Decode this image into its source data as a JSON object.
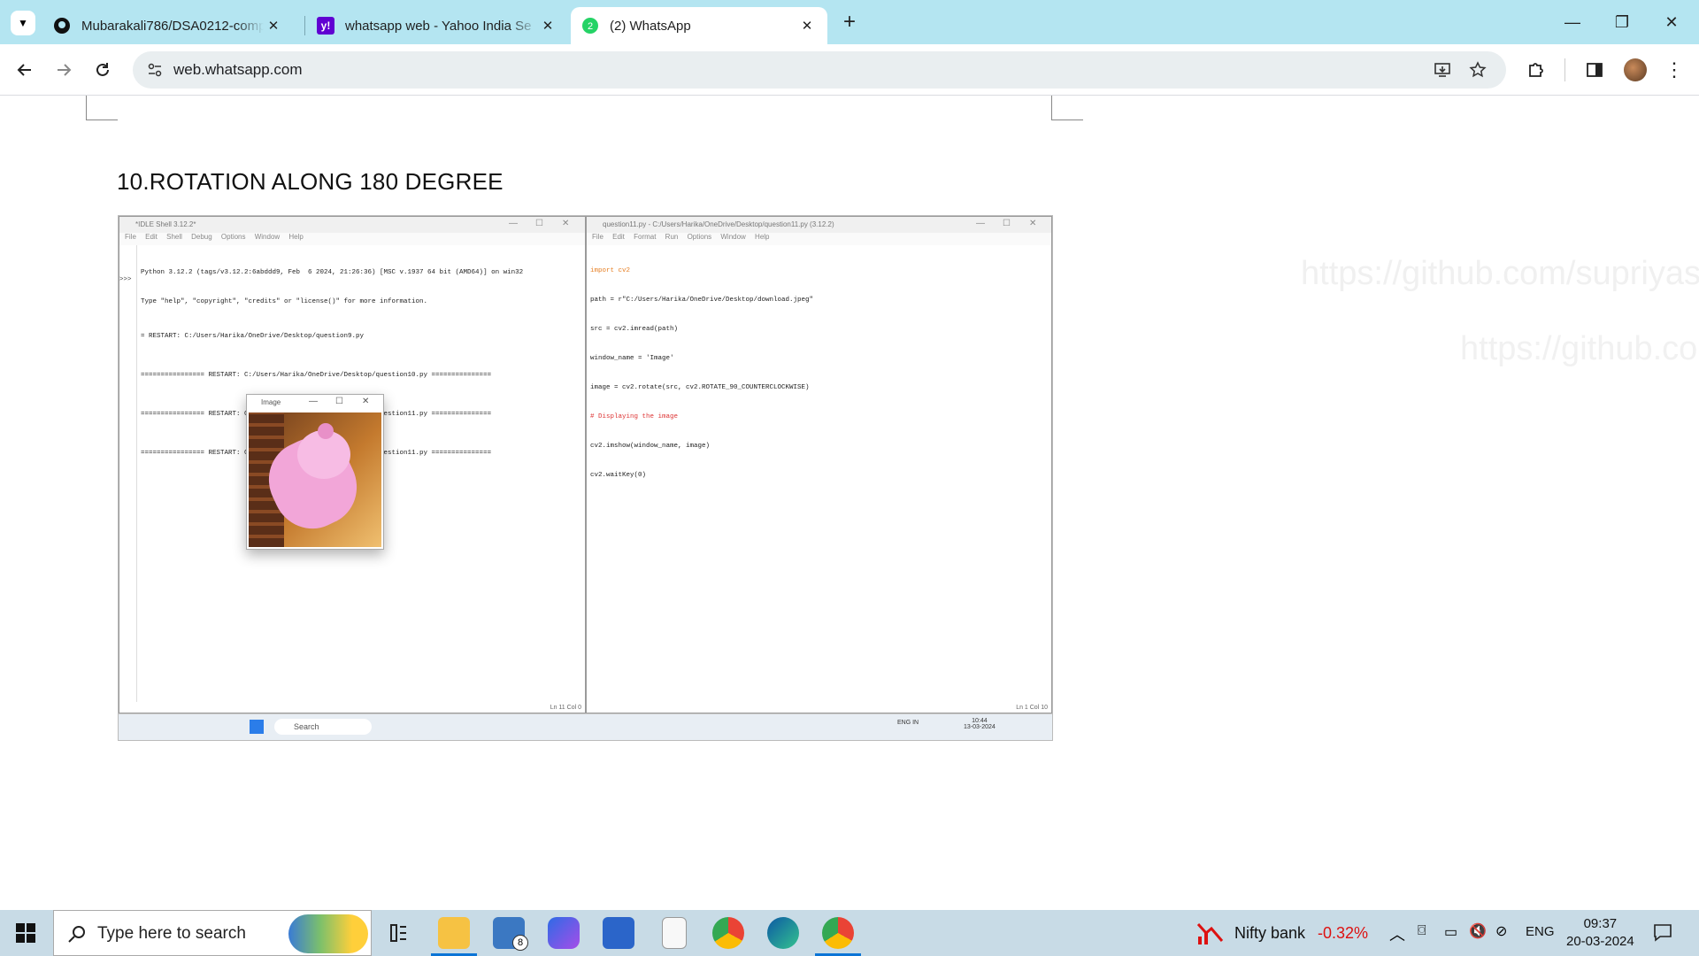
{
  "browser": {
    "tabs": [
      {
        "title": "Mubarakali786/DSA0212-comp",
        "icon": "github-icon",
        "active": false
      },
      {
        "title": "whatsapp web - Yahoo India Se",
        "icon": "yahoo-icon",
        "active": false
      },
      {
        "title": "(2) WhatsApp",
        "icon": "whatsapp-icon",
        "active": true
      }
    ],
    "url": "web.whatsapp.com"
  },
  "page": {
    "heading": "10.ROTATION ALONG 180 DEGREE",
    "shell": {
      "title": "*IDLE Shell 3.12.2*",
      "menu": "File Edit Shell Debug Options Window Help",
      "lines": [
        "Python 3.12.2 (tags/v3.12.2:6abddd9, Feb  6 2024, 21:26:36) [MSC v.1937 64 bit (AMD64)] on win32",
        "Type \"help\", \"copyright\", \"credits\" or \"license()\" for more information.",
        "= RESTART: C:/Users/Harika/OneDrive/Desktop/question9.py",
        "================ RESTART: C:/Users/Harika/OneDrive/Desktop/question10.py ===============",
        "================ RESTART: C:/Users/Harika/OneDrive/Desktop/question11.py ===============",
        "================ RESTART: C:/Users/Harika/OneDrive/Desktop/question11.py ==============="
      ],
      "status": "Ln 11  Col 0"
    },
    "editor": {
      "title": "question11.py - C:/Users/Harika/OneDrive/Desktop/question11.py (3.12.2)",
      "menu": "File Edit Format Run Options Window Help",
      "lines": [
        "import cv2",
        "path = r\"C:/Users/Harika/OneDrive/Desktop/download.jpeg\"",
        "src = cv2.imread(path)",
        "window_name = 'Image'",
        "image = cv2.rotate(src, cv2.ROTATE_90_COUNTERCLOCKWISE)",
        "# Displaying the image",
        "cv2.imshow(window_name, image)",
        "cv2.waitKey(0)"
      ],
      "status": "Ln 1  Col 10"
    },
    "image_window_title": "Image",
    "mini_taskbar": {
      "search": "Search",
      "time": "10:44",
      "date": "13-03-2024",
      "lang": "ENG IN"
    },
    "ghost_text_1": "https://github.com/supriyas",
    "ghost_text_2": "https://github.co"
  },
  "taskbar": {
    "search_placeholder": "Type here to search",
    "mail_badge": "8",
    "stock_name": "Nifty bank",
    "stock_change": "-0.32%",
    "language": "ENG",
    "time": "09:37",
    "date": "20-03-2024"
  },
  "colors": {
    "tabstrip": "#b4e5f1",
    "taskbar": "#c8dbe6",
    "negative": "#dd1111"
  }
}
